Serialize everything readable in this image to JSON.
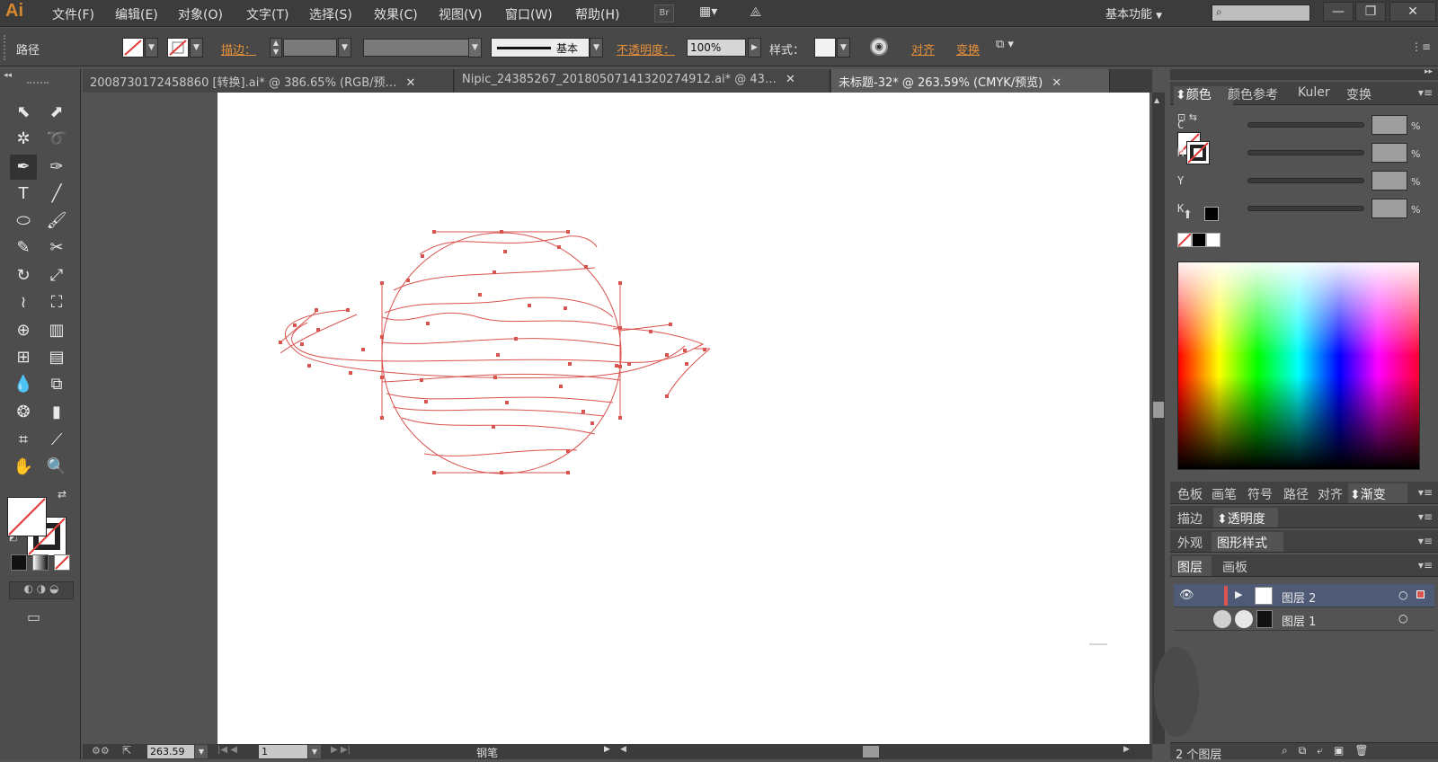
{
  "app": {
    "logo": "Ai"
  },
  "menubar": {
    "items": [
      "文件(F)",
      "编辑(E)",
      "对象(O)",
      "文字(T)",
      "选择(S)",
      "效果(C)",
      "视图(V)",
      "窗口(W)",
      "帮助(H)"
    ],
    "bridge_label": "Br",
    "workspace": "基本功能",
    "window_buttons": {
      "minimize": "—",
      "restore": "❐",
      "close": "✕"
    }
  },
  "control": {
    "object_type": "路径",
    "stroke_label": "描边：",
    "brush_label": "基本",
    "opacity_label": "不透明度：",
    "opacity_value": "100%",
    "style_label": "样式：",
    "align_label": "对齐",
    "transform_label": "变换"
  },
  "tabs": [
    {
      "label": "2008730172458860 [转换].ai* @ 386.65% (RGB/预…",
      "close": "✕"
    },
    {
      "label": "Nipic_24385267_20180507141320274912.ai* @ 43…",
      "close": "✕"
    },
    {
      "label": "未标题-32* @ 263.59% (CMYK/预览)",
      "close": "✕"
    }
  ],
  "status": {
    "zoom": "263.59",
    "page": "1",
    "tool": "钢笔"
  },
  "color_panel": {
    "tabs": [
      "颜色",
      "颜色参考",
      "Kuler",
      "变换"
    ],
    "channels": [
      {
        "label": "C",
        "value": "",
        "unit": "%"
      },
      {
        "label": "M",
        "value": "",
        "unit": "%"
      },
      {
        "label": "Y",
        "value": "",
        "unit": "%"
      },
      {
        "label": "K",
        "value": "",
        "unit": "%"
      }
    ]
  },
  "swatch_panel": {
    "tabs": [
      "色板",
      "画笔",
      "符号",
      "路径",
      "对齐",
      "渐变"
    ]
  },
  "stroke_panel": {
    "tabs": [
      "描边",
      "透明度"
    ]
  },
  "appearance_panel": {
    "tabs": [
      "外观",
      "图形样式"
    ]
  },
  "layers_panel": {
    "tabs": [
      "图层",
      "画板"
    ],
    "layers": [
      {
        "name": "图层 2"
      },
      {
        "name": "图层 1"
      }
    ],
    "count": "2 个图层"
  },
  "colors": {
    "accent": "#e8913a",
    "path": "#d9534f",
    "selection": "#4f5b76"
  }
}
